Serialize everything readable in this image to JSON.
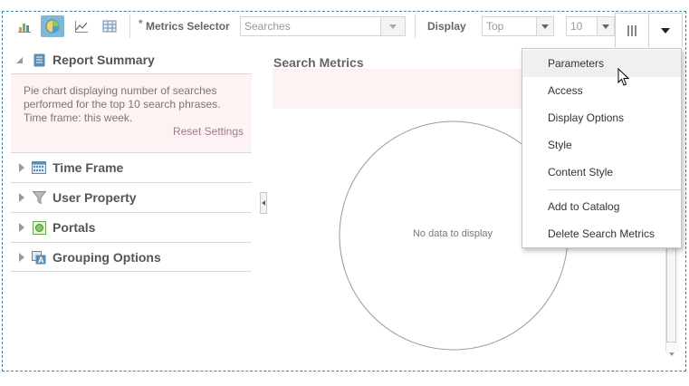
{
  "toolbar": {
    "chart_icons": [
      "bar-chart-icon",
      "pie-chart-icon",
      "line-chart-icon",
      "table-icon"
    ],
    "metrics_required_mark": "*",
    "metrics_label": "Metrics Selector",
    "metrics_value": "Searches",
    "display_label": "Display",
    "display_value": "Top",
    "count_value": "10",
    "panel_toggle_icon": "columns-icon",
    "menu_toggle_icon": "caret-down-icon"
  },
  "left_panel": {
    "sections": [
      {
        "label": "Report Summary",
        "icon": "document-icon",
        "expanded": true
      },
      {
        "label": "Time Frame",
        "icon": "calendar-icon",
        "expanded": false
      },
      {
        "label": "User Property",
        "icon": "filter-icon",
        "expanded": false
      },
      {
        "label": "Portals",
        "icon": "portal-icon",
        "expanded": false
      },
      {
        "label": "Grouping Options",
        "icon": "grouping-icon",
        "expanded": false
      }
    ],
    "summary_text": "Pie chart displaying number of searches performed for the top 10 search phrases. Time frame: this week.",
    "reset_link": "Reset Settings"
  },
  "main": {
    "title": "Search Metrics",
    "empty_message": "No data to display"
  },
  "menu": {
    "items": [
      {
        "label": "Parameters",
        "highlighted": true
      },
      {
        "label": "Access"
      },
      {
        "label": "Display Options"
      },
      {
        "label": "Style"
      },
      {
        "label": "Content Style"
      },
      {
        "label": "Add to Catalog"
      },
      {
        "label": "Delete Search Metrics"
      }
    ]
  },
  "colors": {
    "selected_icon_bg": "#7fb7d9",
    "summary_bg": "#fdf3f3",
    "frame_border": "#3f86a6"
  }
}
